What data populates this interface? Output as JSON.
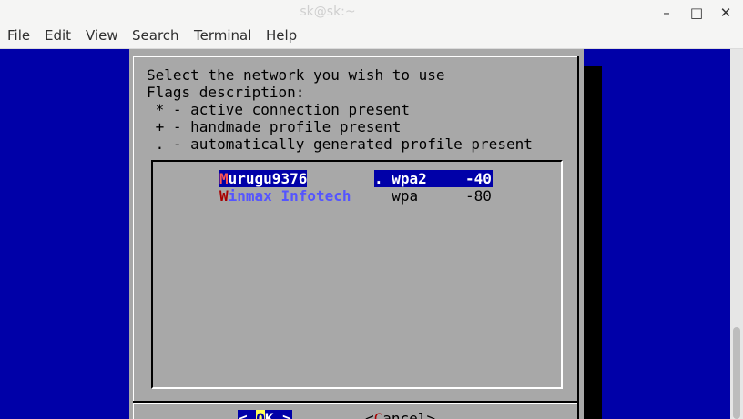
{
  "window": {
    "title": "sk@sk:~",
    "minimize": "–",
    "maximize": "□",
    "close": "✕"
  },
  "menu": [
    "File",
    "Edit",
    "View",
    "Search",
    "Terminal",
    "Help"
  ],
  "dialog": {
    "lines": [
      "Select the network you wish to use",
      "Flags description:",
      " * - active connection present",
      " + - handmade profile present",
      " . - automatically generated profile present"
    ],
    "networks": [
      {
        "hotkey": "M",
        "rest": "urugu9376",
        "flag": ".",
        "security": "wpa2",
        "signal": "-40",
        "selected": true
      },
      {
        "hotkey": "W",
        "rest": "inmax Infotech",
        "flag": " ",
        "security": "wpa",
        "signal": "-80",
        "selected": false
      }
    ],
    "ok": {
      "left": "< ",
      "hot": "O",
      "rest": "K",
      "right": " >"
    },
    "cancel": {
      "left": "<",
      "hot": "C",
      "rest": "ancel",
      "right": ">"
    }
  },
  "colors": {
    "terminal_bg": "#0000a8",
    "dialog_bg": "#a8a8a8",
    "highlight_bg": "#0000a8"
  }
}
